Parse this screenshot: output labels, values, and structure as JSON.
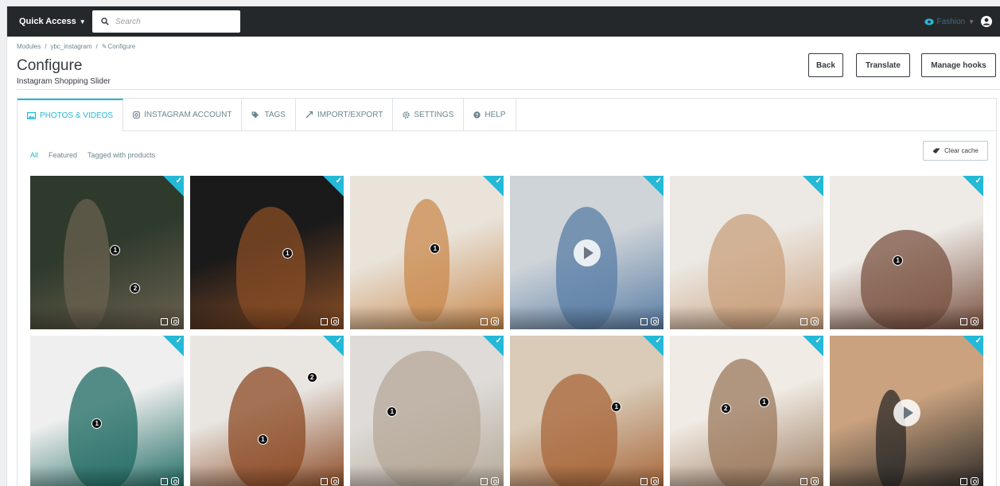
{
  "topbar": {
    "quick_access": "Quick Access",
    "search_placeholder": "Search",
    "shop_name": "Fashion"
  },
  "breadcrumb": [
    "Modules",
    "/",
    "ybc_instagram",
    "/",
    "Configure"
  ],
  "page": {
    "title": "Configure",
    "subtitle": "Instagram Shopping Slider"
  },
  "header_buttons": {
    "back": "Back",
    "translate": "Translate",
    "manage_hooks": "Manage hooks"
  },
  "tabs": [
    {
      "label": "PHOTOS & VIDEOS",
      "icon": "image-icon",
      "active": true
    },
    {
      "label": "INSTAGRAM ACCOUNT",
      "icon": "instagram-icon",
      "active": false
    },
    {
      "label": "TAGS",
      "icon": "tags-icon",
      "active": false
    },
    {
      "label": "IMPORT/EXPORT",
      "icon": "transfer-icon",
      "active": false
    },
    {
      "label": "SETTINGS",
      "icon": "gear-icon",
      "active": false
    },
    {
      "label": "HELP",
      "icon": "help-icon",
      "active": false
    }
  ],
  "filters": [
    {
      "label": "All",
      "active": true
    },
    {
      "label": "Featured",
      "active": false
    },
    {
      "label": "Tagged with products",
      "active": false
    }
  ],
  "clear_cache": "Clear cache",
  "colors": {
    "accent": "#25b9d7",
    "topbar": "#25282b"
  },
  "media": [
    {
      "kind": "photo",
      "selected": true,
      "bg": [
        "#2e3a2c",
        "#6b6150"
      ],
      "pins": [
        "1",
        "2"
      ]
    },
    {
      "kind": "photo",
      "selected": true,
      "bg": [
        "#1b1a1a",
        "#8a4e26"
      ],
      "pins": [
        "1"
      ]
    },
    {
      "kind": "photo",
      "selected": true,
      "bg": [
        "#e9e3da",
        "#c98a4e"
      ],
      "pins": [
        "1"
      ]
    },
    {
      "kind": "video",
      "selected": true,
      "bg": [
        "#cfd4d8",
        "#5a7ea6"
      ],
      "pins": []
    },
    {
      "kind": "photo",
      "selected": true,
      "bg": [
        "#ece8e3",
        "#c9a07c"
      ],
      "pins": []
    },
    {
      "kind": "photo",
      "selected": true,
      "bg": [
        "#eeeae6",
        "#7a5140"
      ],
      "pins": [
        "1"
      ]
    },
    {
      "kind": "photo",
      "selected": true,
      "bg": [
        "#efefef",
        "#1f6b63"
      ],
      "pins": [
        "1"
      ]
    },
    {
      "kind": "photo",
      "selected": true,
      "bg": [
        "#e9e6e2",
        "#8c4a24"
      ],
      "pins": [
        "2",
        "1"
      ]
    },
    {
      "kind": "photo",
      "selected": true,
      "bg": [
        "#dedbd8",
        "#b5a898"
      ],
      "pins": [
        "1"
      ]
    },
    {
      "kind": "photo",
      "selected": true,
      "bg": [
        "#d9cbb8",
        "#a8673a"
      ],
      "pins": [
        "1"
      ]
    },
    {
      "kind": "photo",
      "selected": true,
      "bg": [
        "#f0ebe4",
        "#9c7a5e"
      ],
      "pins": [
        "2",
        "1"
      ]
    },
    {
      "kind": "video",
      "selected": true,
      "bg": [
        "#caa27f",
        "#2c2a28"
      ],
      "pins": []
    }
  ]
}
